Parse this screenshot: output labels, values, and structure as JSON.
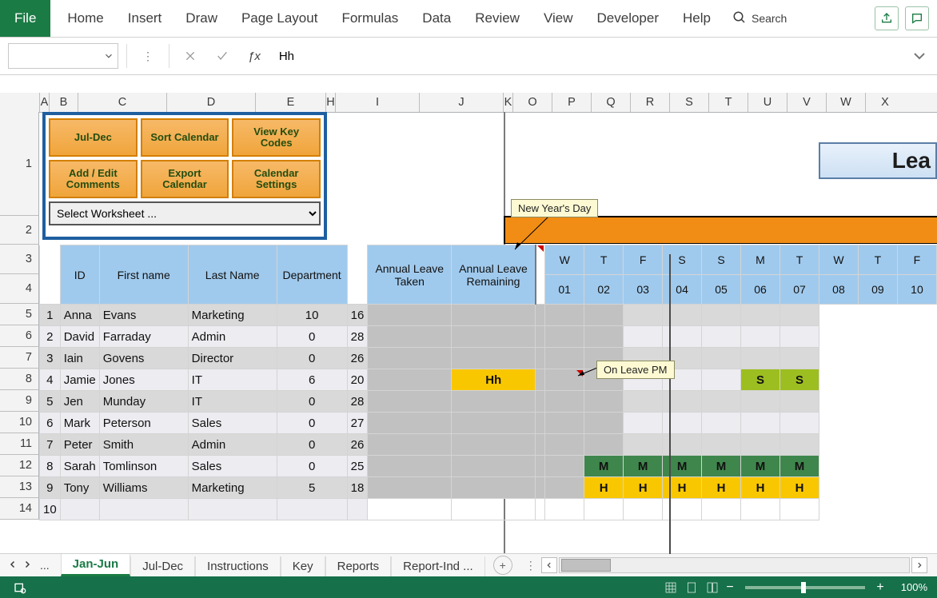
{
  "ribbon": {
    "file": "File",
    "tabs": [
      "Home",
      "Insert",
      "Draw",
      "Page Layout",
      "Formulas",
      "Data",
      "Review",
      "View",
      "Developer",
      "Help"
    ],
    "search": "Search"
  },
  "formula_bar": {
    "value": "Hh"
  },
  "column_headers": {
    "A": "A",
    "B": "B",
    "C": "C",
    "D": "D",
    "E": "E",
    "H": "H",
    "I": "I",
    "J": "J",
    "K": "K",
    "O": "O",
    "P": "P",
    "Q": "Q",
    "R": "R",
    "S": "S",
    "T": "T",
    "U": "U",
    "V": "V",
    "W": "W",
    "X": "X"
  },
  "row_headers": [
    "1",
    "2",
    "3",
    "4",
    "5",
    "6",
    "7",
    "8",
    "9",
    "10",
    "11",
    "12",
    "13",
    "14"
  ],
  "panel": {
    "buttons": [
      [
        "Jul-Dec",
        "Sort Calendar",
        "View Key Codes"
      ],
      [
        "Add / Edit Comments",
        "Export Calendar",
        "Calendar Settings"
      ]
    ],
    "select_placeholder": "Select Worksheet ..."
  },
  "title_fragment": "Lea",
  "tooltips": {
    "new_year": "New Year's Day",
    "on_leave": "On Leave PM"
  },
  "table": {
    "headers": {
      "id": "ID",
      "first": "First name",
      "last": "Last Name",
      "dept": "Department",
      "taken": "Annual Leave Taken",
      "remain": "Annual Leave Remaining"
    },
    "day_letters": [
      "W",
      "T",
      "F",
      "S",
      "S",
      "M",
      "T",
      "W",
      "T",
      "F"
    ],
    "day_nums": [
      "01",
      "02",
      "03",
      "04",
      "05",
      "06",
      "07",
      "08",
      "09",
      "10"
    ],
    "rows": [
      {
        "id": "1",
        "first": "Anna",
        "last": "Evans",
        "dept": "Marketing",
        "taken": "10",
        "remain": "16",
        "cal": [
          "",
          "",
          "",
          "",
          "",
          "",
          "",
          "",
          "",
          ""
        ]
      },
      {
        "id": "2",
        "first": "David",
        "last": "Farraday",
        "dept": "Admin",
        "taken": "0",
        "remain": "28",
        "cal": [
          "",
          "",
          "",
          "",
          "",
          "",
          "",
          "",
          "",
          ""
        ]
      },
      {
        "id": "3",
        "first": "Iain",
        "last": "Govens",
        "dept": "Director",
        "taken": "0",
        "remain": "26",
        "cal": [
          "",
          "",
          "",
          "",
          "",
          "",
          "",
          "",
          "",
          ""
        ]
      },
      {
        "id": "4",
        "first": "Jamie",
        "last": "Jones",
        "dept": "IT",
        "taken": "6",
        "remain": "20",
        "cal": [
          "",
          "Hh",
          "",
          "",
          "",
          "",
          "",
          "",
          "S",
          "S"
        ]
      },
      {
        "id": "5",
        "first": "Jen",
        "last": "Munday",
        "dept": "IT",
        "taken": "0",
        "remain": "28",
        "cal": [
          "",
          "",
          "",
          "",
          "",
          "",
          "",
          "",
          "",
          ""
        ]
      },
      {
        "id": "6",
        "first": "Mark",
        "last": "Peterson",
        "dept": "Sales",
        "taken": "0",
        "remain": "27",
        "cal": [
          "",
          "",
          "",
          "",
          "",
          "",
          "",
          "",
          "",
          ""
        ]
      },
      {
        "id": "7",
        "first": "Peter",
        "last": "Smith",
        "dept": "Admin",
        "taken": "0",
        "remain": "26",
        "cal": [
          "",
          "",
          "",
          "",
          "",
          "",
          "",
          "",
          "",
          ""
        ]
      },
      {
        "id": "8",
        "first": "Sarah",
        "last": "Tomlinson",
        "dept": "Sales",
        "taken": "0",
        "remain": "25",
        "cal": [
          "",
          "",
          "",
          "",
          "M",
          "M",
          "M",
          "M",
          "M",
          "M"
        ]
      },
      {
        "id": "9",
        "first": "Tony",
        "last": "Williams",
        "dept": "Marketing",
        "taken": "5",
        "remain": "18",
        "cal": [
          "",
          "",
          "",
          "",
          "H",
          "H",
          "H",
          "H",
          "H",
          "H"
        ]
      },
      {
        "id": "10",
        "first": "",
        "last": "",
        "dept": "",
        "taken": "",
        "remain": "",
        "cal": [
          "",
          "",
          "",
          "",
          "",
          "",
          "",
          "",
          "",
          ""
        ]
      }
    ]
  },
  "tabs_bottom": {
    "prefix": "...",
    "tabs": [
      "Jan-Jun",
      "Jul-Dec",
      "Instructions",
      "Key",
      "Reports",
      "Report-Ind ..."
    ],
    "active_index": 0
  },
  "status": {
    "zoom": "100%"
  }
}
